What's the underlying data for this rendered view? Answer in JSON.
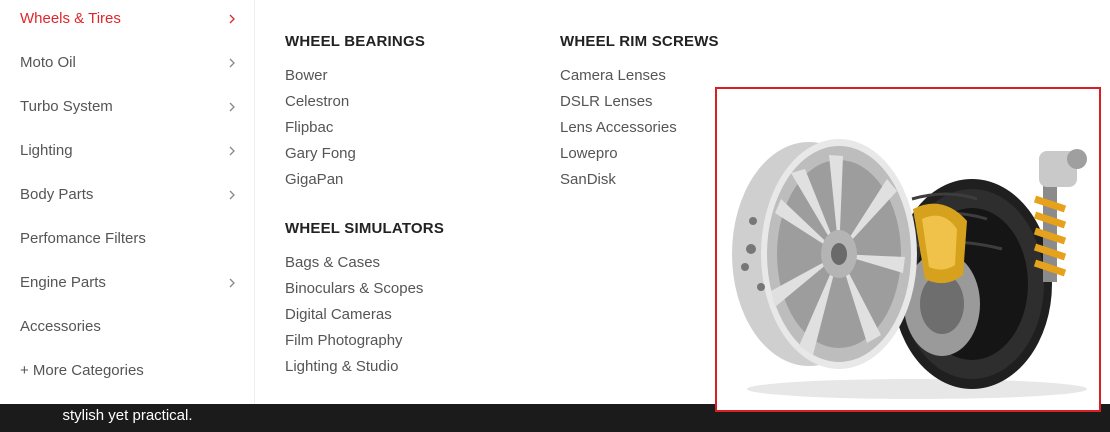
{
  "sidebar": {
    "items": [
      {
        "label": "Wheels & Tires",
        "chevron": true,
        "active": true
      },
      {
        "label": "Moto Oil",
        "chevron": true
      },
      {
        "label": "Turbo System",
        "chevron": true
      },
      {
        "label": "Lighting",
        "chevron": true
      },
      {
        "label": "Body Parts",
        "chevron": true
      },
      {
        "label": "Perfomance Filters",
        "chevron": false
      },
      {
        "label": "Engine Parts",
        "chevron": true
      },
      {
        "label": "Accessories",
        "chevron": false
      },
      {
        "label": "+ More Categories",
        "chevron": false
      }
    ],
    "chevron_icon": "chevron-right-icon",
    "active_color": "#e0262c"
  },
  "promo": {
    "text": "stylish yet practical."
  },
  "mega_menu": {
    "col1": {
      "title": "WHEEL BEARINGS",
      "links": [
        "Bower",
        "Celestron",
        "Flipbac",
        "Gary Fong",
        "GigaPan"
      ]
    },
    "col2": {
      "title": "WHEEL SIMULATORS",
      "links": [
        "Bags & Cases",
        "Binoculars & Scopes",
        "Digital Cameras",
        "Film Photography",
        "Lighting & Studio"
      ]
    },
    "col3": {
      "title": "WHEEL RIM SCREWS",
      "links": [
        "Camera Lenses",
        "DSLR Lenses",
        "Lens Accessories",
        "Lowepro",
        "SanDisk"
      ]
    }
  },
  "banner": {
    "image": "wheel-assembly-image",
    "border_color": "#d81f26"
  }
}
